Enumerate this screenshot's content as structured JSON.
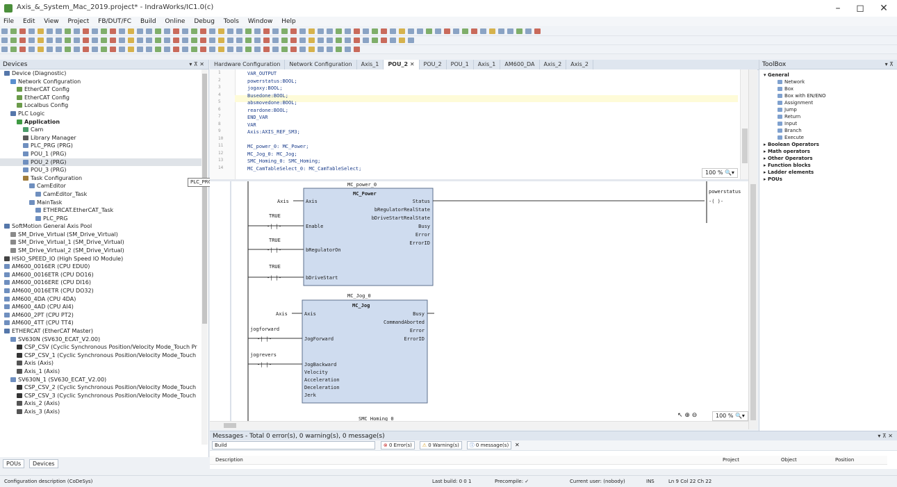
{
  "window": {
    "title": "Axis_&_System_Mac_2019.project* - IndraWorks/IC1.0(c)",
    "controls": [
      "–",
      "◻",
      "✕"
    ]
  },
  "menu": [
    "File",
    "Edit",
    "View",
    "Project",
    "FB/DUT/FC",
    "Build",
    "Online",
    "Debug",
    "Tools",
    "Window",
    "Help"
  ],
  "devices_panel": {
    "title": "Devices",
    "tooltip": "PLC_PRG",
    "tree": [
      {
        "label": "Device (Diagnostic)",
        "indent": 0,
        "color": "#5577aa"
      },
      {
        "label": "Network Configuration",
        "indent": 1,
        "color": "#5a8fcf"
      },
      {
        "label": "EtherCAT Config",
        "indent": 2,
        "color": "#6b9b4a"
      },
      {
        "label": "EtherCAT Config",
        "indent": 2,
        "color": "#6b9b4a"
      },
      {
        "label": "Localbus Config",
        "indent": 2,
        "color": "#6b9b4a"
      },
      {
        "label": "PLC Logic",
        "indent": 1,
        "color": "#5577aa"
      },
      {
        "label": "Application",
        "indent": 2,
        "color": "#3e9a43",
        "bold": true
      },
      {
        "label": "Cam",
        "indent": 3,
        "color": "#4c9c6a"
      },
      {
        "label": "Library Manager",
        "indent": 3,
        "color": "#5a5a5a"
      },
      {
        "label": "PLC_PRG (PRG)",
        "indent": 3,
        "color": "#6f8fbf"
      },
      {
        "label": "POU_1 (PRG)",
        "indent": 3,
        "color": "#6f8fbf"
      },
      {
        "label": "POU_2 (PRG)",
        "indent": 3,
        "color": "#6f8fbf",
        "selected": true
      },
      {
        "label": "POU_3 (PRG)",
        "indent": 3,
        "color": "#6f8fbf"
      },
      {
        "label": "Task Configuration",
        "indent": 3,
        "color": "#a07c3b"
      },
      {
        "label": "CamEditor",
        "indent": 4,
        "color": "#6f8fbf"
      },
      {
        "label": "CamEditor_Task",
        "indent": 5,
        "color": "#6f8fbf"
      },
      {
        "label": "MainTask",
        "indent": 4,
        "color": "#6f8fbf"
      },
      {
        "label": "ETHERCAT.EtherCAT_Task",
        "indent": 5,
        "color": "#6f8fbf"
      },
      {
        "label": "PLC_PRG",
        "indent": 5,
        "color": "#6f8fbf"
      },
      {
        "label": "SoftMotion General Axis Pool",
        "indent": 0,
        "color": "#5577aa"
      },
      {
        "label": "SM_Drive_Virtual (SM_Drive_Virtual)",
        "indent": 1,
        "color": "#8a8a8a"
      },
      {
        "label": "SM_Drive_Virtual_1 (SM_Drive_Virtual)",
        "indent": 1,
        "color": "#8a8a8a"
      },
      {
        "label": "SM_Drive_Virtual_2 (SM_Drive_Virtual)",
        "indent": 1,
        "color": "#8a8a8a"
      },
      {
        "label": "HSIO_SPEED_IO (High Speed IO Module)",
        "indent": 0,
        "color": "#444"
      },
      {
        "label": "AM600_0016ER (CPU EDU0)",
        "indent": 0,
        "color": "#6f8fbf"
      },
      {
        "label": "AM600_0016ETR (CPU DO16)",
        "indent": 0,
        "color": "#6f8fbf"
      },
      {
        "label": "AM600_0016ERE (CPU DI16)",
        "indent": 0,
        "color": "#6f8fbf"
      },
      {
        "label": "AM600_0016ETR (CPU DO32)",
        "indent": 0,
        "color": "#6f8fbf"
      },
      {
        "label": "AM600_4DA (CPU 4DA)",
        "indent": 0,
        "color": "#6f8fbf"
      },
      {
        "label": "AM600_4AD (CPU AI4)",
        "indent": 0,
        "color": "#6f8fbf"
      },
      {
        "label": "AM600_2PT (CPU PT2)",
        "indent": 0,
        "color": "#6f8fbf"
      },
      {
        "label": "AM600_4TT (CPU TT4)",
        "indent": 0,
        "color": "#6f8fbf"
      },
      {
        "label": "ETHERCAT (EtherCAT Master)",
        "indent": 0,
        "color": "#5577aa"
      },
      {
        "label": "SV630N (SV630_ECAT_V2.00)",
        "indent": 1,
        "color": "#6f8fbf"
      },
      {
        "label": "CSP_CSV (Cyclic Synchronous Position/Velocity Mode_Touch Pr",
        "indent": 2,
        "color": "#333"
      },
      {
        "label": "CSP_CSV_1 (Cyclic Synchronous Position/Velocity Mode_Touch",
        "indent": 2,
        "color": "#333"
      },
      {
        "label": "Axis (Axis)",
        "indent": 2,
        "color": "#555"
      },
      {
        "label": "Axis_1 (Axis)",
        "indent": 2,
        "color": "#555"
      },
      {
        "label": "SV630N_1 (SV630_ECAT_V2.00)",
        "indent": 1,
        "color": "#6f8fbf"
      },
      {
        "label": "CSP_CSV_2 (Cyclic Synchronous Position/Velocity Mode_Touch",
        "indent": 2,
        "color": "#333"
      },
      {
        "label": "CSP_CSV_3 (Cyclic Synchronous Position/Velocity Mode_Touch",
        "indent": 2,
        "color": "#333"
      },
      {
        "label": "Axis_2 (Axis)",
        "indent": 2,
        "color": "#555"
      },
      {
        "label": "Axis_3 (Axis)",
        "indent": 2,
        "color": "#555"
      }
    ]
  },
  "bottom_tabs": [
    "POUs",
    "Devices"
  ],
  "editor": {
    "tabs": [
      {
        "label": "Hardware Configuration"
      },
      {
        "label": "Network Configuration"
      },
      {
        "label": "Axis_1"
      },
      {
        "label": "POU_2",
        "active": true
      },
      {
        "label": "POU_2"
      },
      {
        "label": "POU_1"
      },
      {
        "label": "Axis_1"
      },
      {
        "label": "AM600_DA"
      },
      {
        "label": "Axis_2"
      },
      {
        "label": "Axis_2"
      }
    ],
    "declaration": [
      {
        "n": "1",
        "text": "VAR_OUTPUT"
      },
      {
        "n": "2",
        "text": "    powerstatus:BOOL;"
      },
      {
        "n": "3",
        "text": "    jogaxy:BOOL;"
      },
      {
        "n": "4",
        "text": "    Busedone:BOOL;"
      },
      {
        "n": "5",
        "text": "    absmovedone:BOOL;"
      },
      {
        "n": "6",
        "text": "    reardone:BOOL;"
      },
      {
        "n": "7",
        "text": "END_VAR"
      },
      {
        "n": "8",
        "text": "VAR"
      },
      {
        "n": "9",
        "text": "    Axis:AXIS_REF_SM3;"
      },
      {
        "n": "10",
        "text": ""
      },
      {
        "n": "11",
        "text": "    MC_power_0: MC_Power;"
      },
      {
        "n": "12",
        "text": "    MC_Jog_0: MC_Jog;"
      },
      {
        "n": "13",
        "text": "    SMC_Homing_0: SMC_Homing;"
      },
      {
        "n": "14",
        "text": "    MC_CamTableSelect_0: MC_CamTableSelect;"
      }
    ],
    "decl_zoom": "100 %",
    "fbd_zoom": "100 %",
    "rungs": [
      {
        "instance": "MC_power_0",
        "type": "MC_Power",
        "inputs": [
          "Axis",
          "Enable",
          "bRegulatorOn",
          "bDriveStart"
        ],
        "outputs": [
          "Status",
          "bRegulatorRealState",
          "bDriveStartRealState",
          "Busy",
          "Error",
          "ErrorID"
        ],
        "axis_var": "Axis",
        "contacts": [
          "TRUE",
          "TRUE",
          "TRUE"
        ],
        "coil": "powerstatus"
      },
      {
        "instance": "MC_Jog_0",
        "type": "MC_Jog",
        "inputs": [
          "Axis",
          "JogForward",
          "JogBackward",
          "Velocity",
          "Acceleration",
          "Deceleration",
          "Jerk"
        ],
        "outputs": [
          "Busy",
          "CommandAborted",
          "Error",
          "ErrorID"
        ],
        "axis_var": "Axis",
        "contacts": [
          "jogforward",
          "jogrevers"
        ]
      }
    ],
    "rung3_label": "SMC_Homing_0"
  },
  "toolbox": {
    "title": "ToolBox",
    "general": "General",
    "items": [
      "Network",
      "Box",
      "Box with EN/ENO",
      "Assignment",
      "Jump",
      "Return",
      "Input",
      "Branch",
      "Execute"
    ],
    "categories": [
      "Boolean Operators",
      "Math operators",
      "Other Operators",
      "Function blocks",
      "Ladder elements",
      "POUs"
    ]
  },
  "messages": {
    "title": "Messages - Total 0 error(s), 0 warning(s), 0 message(s)",
    "source": "Build",
    "filters": [
      "0 Error(s)",
      "0 Warning(s)",
      "0 message(s)"
    ],
    "columns": [
      "Description",
      "Project",
      "Object",
      "Position"
    ]
  },
  "statusbar": {
    "left": "Configuration description (CoDeSys)",
    "last_build": "Last build: 0  0  1",
    "precompile": "Precompile: ✓",
    "user": "Current user: (nobody)",
    "ins": "INS",
    "position": "Ln 9  Col 22  Ch 22"
  }
}
